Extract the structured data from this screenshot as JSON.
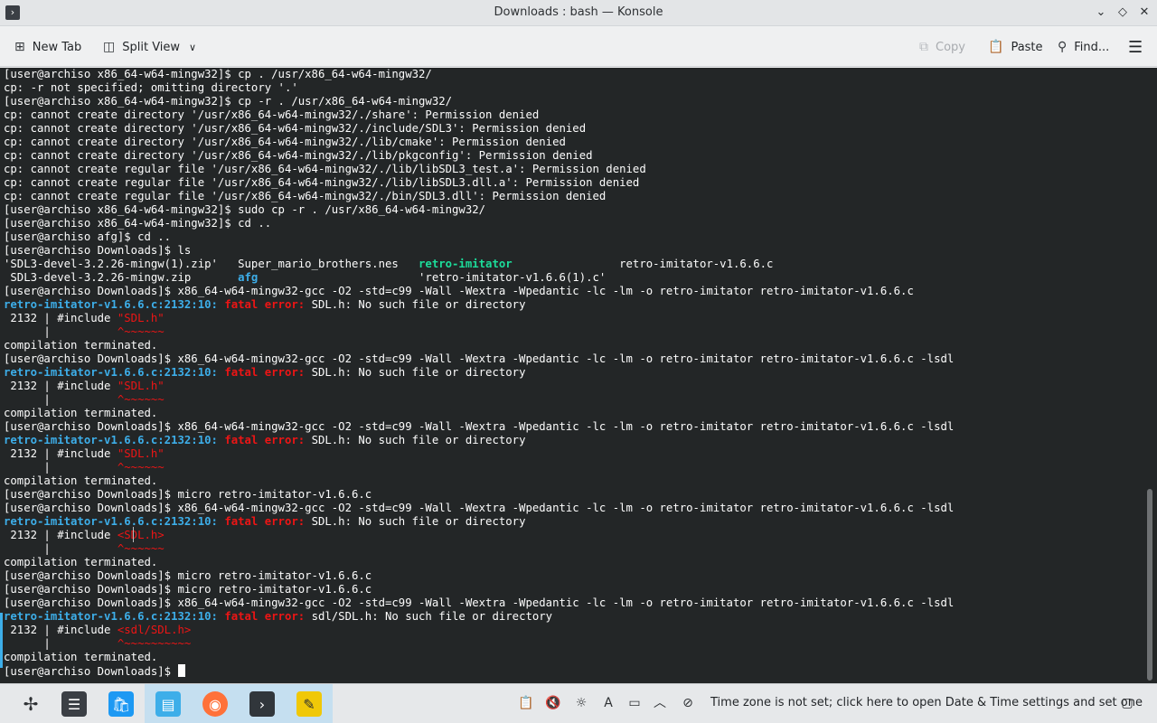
{
  "window": {
    "title": "Downloads : bash — Konsole",
    "app_icon": "terminal-icon",
    "buttons": [
      "chevron-down-icon",
      "diamond-icon",
      "close-icon"
    ]
  },
  "toolbar": {
    "new_tab": "New Tab",
    "split_view": "Split View",
    "copy": "Copy",
    "paste": "Paste",
    "find": "Find..."
  },
  "terminal": {
    "lines": [
      [
        {
          "t": "[user@archiso x86_64-w64-mingw32]$ cp . /usr/x86_64-w64-mingw32/"
        }
      ],
      [
        {
          "t": "cp: -r not specified; omitting directory '.'"
        }
      ],
      [
        {
          "t": "[user@archiso x86_64-w64-mingw32]$ cp -r . /usr/x86_64-w64-mingw32/"
        }
      ],
      [
        {
          "t": "cp: cannot create directory '/usr/x86_64-w64-mingw32/./share': Permission denied"
        }
      ],
      [
        {
          "t": "cp: cannot create directory '/usr/x86_64-w64-mingw32/./include/SDL3': Permission denied"
        }
      ],
      [
        {
          "t": "cp: cannot create directory '/usr/x86_64-w64-mingw32/./lib/cmake': Permission denied"
        }
      ],
      [
        {
          "t": "cp: cannot create directory '/usr/x86_64-w64-mingw32/./lib/pkgconfig': Permission denied"
        }
      ],
      [
        {
          "t": "cp: cannot create regular file '/usr/x86_64-w64-mingw32/./lib/libSDL3_test.a': Permission denied"
        }
      ],
      [
        {
          "t": "cp: cannot create regular file '/usr/x86_64-w64-mingw32/./lib/libSDL3.dll.a': Permission denied"
        }
      ],
      [
        {
          "t": "cp: cannot create regular file '/usr/x86_64-w64-mingw32/./bin/SDL3.dll': Permission denied"
        }
      ],
      [
        {
          "t": "[user@archiso x86_64-w64-mingw32]$ sudo cp -r . /usr/x86_64-w64-mingw32/"
        }
      ],
      [
        {
          "t": "[user@archiso x86_64-w64-mingw32]$ cd .."
        }
      ],
      [
        {
          "t": "[user@archiso afg]$ cd .."
        }
      ],
      [
        {
          "t": "[user@archiso Downloads]$ ls"
        }
      ],
      [
        {
          "t": "'SDL3-devel-3.2.26-mingw(1).zip'   Super_mario_brothers.nes   "
        },
        {
          "t": "retro-imitator",
          "c": "green"
        },
        {
          "t": "                retro-imitator-v1.6.6.c"
        }
      ],
      [
        {
          "t": " SDL3-devel-3.2.26-mingw.zip       "
        },
        {
          "t": "afg",
          "c": "blue"
        },
        {
          "t": "                        'retro-imitator-v1.6.6(1).c'"
        }
      ],
      [
        {
          "t": "[user@archiso Downloads]$ x86_64-w64-mingw32-gcc -O2 -std=c99 -Wall -Wextra -Wpedantic -lc -lm -o retro-imitator retro-imitator-v1.6.6.c"
        }
      ],
      [
        {
          "t": "retro-imitator-v1.6.6.c:2132:10: ",
          "c": "blue"
        },
        {
          "t": "fatal error: ",
          "c": "redb"
        },
        {
          "t": "SDL.h: No such file or directory"
        }
      ],
      [
        {
          "t": " 2132 | #include "
        },
        {
          "t": "\"SDL.h\"",
          "c": "red"
        }
      ],
      [
        {
          "t": "      |          "
        },
        {
          "t": "^~~~~~~",
          "c": "red"
        }
      ],
      [
        {
          "t": "compilation terminated."
        }
      ],
      [
        {
          "t": "[user@archiso Downloads]$ x86_64-w64-mingw32-gcc -O2 -std=c99 -Wall -Wextra -Wpedantic -lc -lm -o retro-imitator retro-imitator-v1.6.6.c -lsdl"
        }
      ],
      [
        {
          "t": "retro-imitator-v1.6.6.c:2132:10: ",
          "c": "blue"
        },
        {
          "t": "fatal error: ",
          "c": "redb"
        },
        {
          "t": "SDL.h: No such file or directory"
        }
      ],
      [
        {
          "t": " 2132 | #include "
        },
        {
          "t": "\"SDL.h\"",
          "c": "red"
        }
      ],
      [
        {
          "t": "      |          "
        },
        {
          "t": "^~~~~~~",
          "c": "red"
        }
      ],
      [
        {
          "t": "compilation terminated."
        }
      ],
      [
        {
          "t": "[user@archiso Downloads]$ x86_64-w64-mingw32-gcc -O2 -std=c99 -Wall -Wextra -Wpedantic -lc -lm -o retro-imitator retro-imitator-v1.6.6.c -lsdl"
        }
      ],
      [
        {
          "t": "retro-imitator-v1.6.6.c:2132:10: ",
          "c": "blue"
        },
        {
          "t": "fatal error: ",
          "c": "redb"
        },
        {
          "t": "SDL.h: No such file or directory"
        }
      ],
      [
        {
          "t": " 2132 | #include "
        },
        {
          "t": "\"SDL.h\"",
          "c": "red"
        }
      ],
      [
        {
          "t": "      |          "
        },
        {
          "t": "^~~~~~~",
          "c": "red"
        }
      ],
      [
        {
          "t": "compilation terminated."
        }
      ],
      [
        {
          "t": "[user@archiso Downloads]$ micro retro-imitator-v1.6.6.c"
        }
      ],
      [
        {
          "t": "[user@archiso Downloads]$ x86_64-w64-mingw32-gcc -O2 -std=c99 -Wall -Wextra -Wpedantic -lc -lm -o retro-imitator retro-imitator-v1.6.6.c -lsdl"
        }
      ],
      [
        {
          "t": "retro-imitator-v1.6.6.c:2132:10: ",
          "c": "blue"
        },
        {
          "t": "fatal error: ",
          "c": "redb"
        },
        {
          "t": "SDL.h: No such file or directory"
        }
      ],
      [
        {
          "t": " 2132 | #include "
        },
        {
          "t": "<SDL.h>",
          "c": "red"
        }
      ],
      [
        {
          "t": "      |          "
        },
        {
          "t": "^~~~~~~",
          "c": "red"
        }
      ],
      [
        {
          "t": "compilation terminated."
        }
      ],
      [
        {
          "t": "[user@archiso Downloads]$ micro retro-imitator-v1.6.6.c"
        }
      ],
      [
        {
          "t": "[user@archiso Downloads]$ micro retro-imitator-v1.6.6.c"
        }
      ],
      [
        {
          "t": "[user@archiso Downloads]$ x86_64-w64-mingw32-gcc -O2 -std=c99 -Wall -Wextra -Wpedantic -lc -lm -o retro-imitator retro-imitator-v1.6.6.c -lsdl"
        }
      ],
      [
        {
          "t": "retro-imitator-v1.6.6.c:2132:10: ",
          "c": "blue"
        },
        {
          "t": "fatal error: ",
          "c": "redb"
        },
        {
          "t": "sdl/SDL.h: No such file or directory"
        }
      ],
      [
        {
          "t": " 2132 | #include "
        },
        {
          "t": "<sdl/SDL.h>",
          "c": "red"
        }
      ],
      [
        {
          "t": "      |          "
        },
        {
          "t": "^~~~~~~~~~~",
          "c": "red"
        }
      ],
      [
        {
          "t": "compilation terminated."
        }
      ],
      [
        {
          "t": "[user@archiso Downloads]$ "
        },
        {
          "cursor": true
        }
      ]
    ]
  },
  "taskbar": {
    "apps": [
      {
        "name": "launcher-icon",
        "color": "#e6e8ea"
      },
      {
        "name": "system-settings-icon",
        "color": "#3b3f45"
      },
      {
        "name": "discover-icon",
        "color": "#1d99f3"
      },
      {
        "name": "file-manager-icon",
        "color": "#3daee9"
      },
      {
        "name": "firefox-icon",
        "color": "#ff7139"
      },
      {
        "name": "konsole-icon",
        "color": "#31363b"
      },
      {
        "name": "kate-icon",
        "color": "#f0c808"
      }
    ],
    "tray_message": "Time zone is not set; click here to open Date & Time settings and set one"
  }
}
